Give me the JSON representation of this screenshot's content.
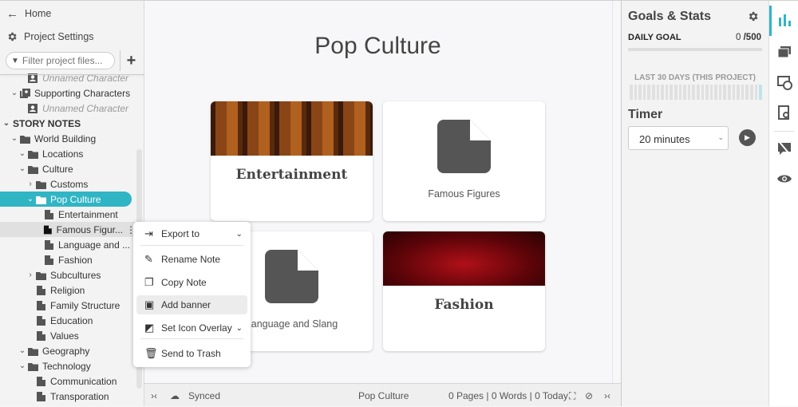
{
  "sidebar": {
    "home": "Home",
    "project_settings": "Project Settings",
    "filter_placeholder": "Filter project files...",
    "add_icon": "+",
    "tree": [
      {
        "label": "Unnamed Character",
        "level": 2,
        "icon": "character",
        "italic": true
      },
      {
        "label": "Supporting Characters",
        "level": 1,
        "icon": "characters",
        "chevron": "down"
      },
      {
        "label": "Unnamed Character",
        "level": 2,
        "icon": "character",
        "italic": true
      },
      {
        "label": "STORY NOTES",
        "level": 0,
        "chevron": "down",
        "heading": true
      },
      {
        "label": "World Building",
        "level": 1,
        "icon": "folder",
        "chevron": "down"
      },
      {
        "label": "Locations",
        "level": 2,
        "icon": "folder",
        "chevron": "down"
      },
      {
        "label": "Culture",
        "level": 2,
        "icon": "folder",
        "chevron": "down"
      },
      {
        "label": "Customs",
        "level": 3,
        "icon": "folder",
        "chevron": "right"
      },
      {
        "label": "Pop Culture",
        "level": 3,
        "icon": "folder",
        "chevron": "down",
        "selected": true
      },
      {
        "label": "Entertainment",
        "level": 4,
        "icon": "doc"
      },
      {
        "label": "Famous Figur...",
        "level": 4,
        "icon": "doc",
        "hover": true
      },
      {
        "label": "Language and ...",
        "level": 4,
        "icon": "doc"
      },
      {
        "label": "Fashion",
        "level": 4,
        "icon": "doc"
      },
      {
        "label": "Subcultures",
        "level": 3,
        "icon": "folder",
        "chevron": "right"
      },
      {
        "label": "Religion",
        "level": 3,
        "icon": "doc"
      },
      {
        "label": "Family Structure",
        "level": 3,
        "icon": "doc"
      },
      {
        "label": "Education",
        "level": 3,
        "icon": "doc"
      },
      {
        "label": "Values",
        "level": 3,
        "icon": "doc"
      },
      {
        "label": "Geography",
        "level": 2,
        "icon": "folder",
        "chevron": "down"
      },
      {
        "label": "Technology",
        "level": 2,
        "icon": "folder",
        "chevron": "down"
      },
      {
        "label": "Communication",
        "level": 3,
        "icon": "doc"
      },
      {
        "label": "Transporation",
        "level": 3,
        "icon": "doc"
      }
    ]
  },
  "main": {
    "title": "Pop Culture",
    "cards": [
      {
        "label": "Entertainment",
        "banner": "violins"
      },
      {
        "label": "Famous Figures",
        "banner": null
      },
      {
        "label": "Language and Slang",
        "banner": null
      },
      {
        "label": "Fashion",
        "banner": "red-fabric"
      }
    ]
  },
  "context_menu": [
    {
      "label": "Export to",
      "icon": "export-icon",
      "submenu": true
    },
    {
      "label": "Rename Note",
      "icon": "pencil-icon"
    },
    {
      "label": "Copy Note",
      "icon": "copy-icon"
    },
    {
      "label": "Add banner",
      "icon": "add-banner-icon",
      "highlighted": true
    },
    {
      "label": "Set Icon Overlay",
      "icon": "icon-overlay-icon",
      "submenu": true
    },
    {
      "label": "Send to Trash",
      "icon": "trash-icon"
    }
  ],
  "status": {
    "sync": "Synced",
    "doc": "Pop Culture",
    "counts": "0 Pages | 0 Words | 0 Today"
  },
  "goals": {
    "title": "Goals & Stats",
    "daily_goal_label": "DAILY GOAL",
    "daily_current": "0",
    "daily_target": "/500",
    "daily_progress": 0,
    "last30_label": "LAST 30 DAYS (THIS PROJECT)",
    "timer_label": "Timer",
    "timer_value": "20 minutes"
  },
  "colors": {
    "accent": "#30b5c4",
    "icon": "#555555"
  }
}
